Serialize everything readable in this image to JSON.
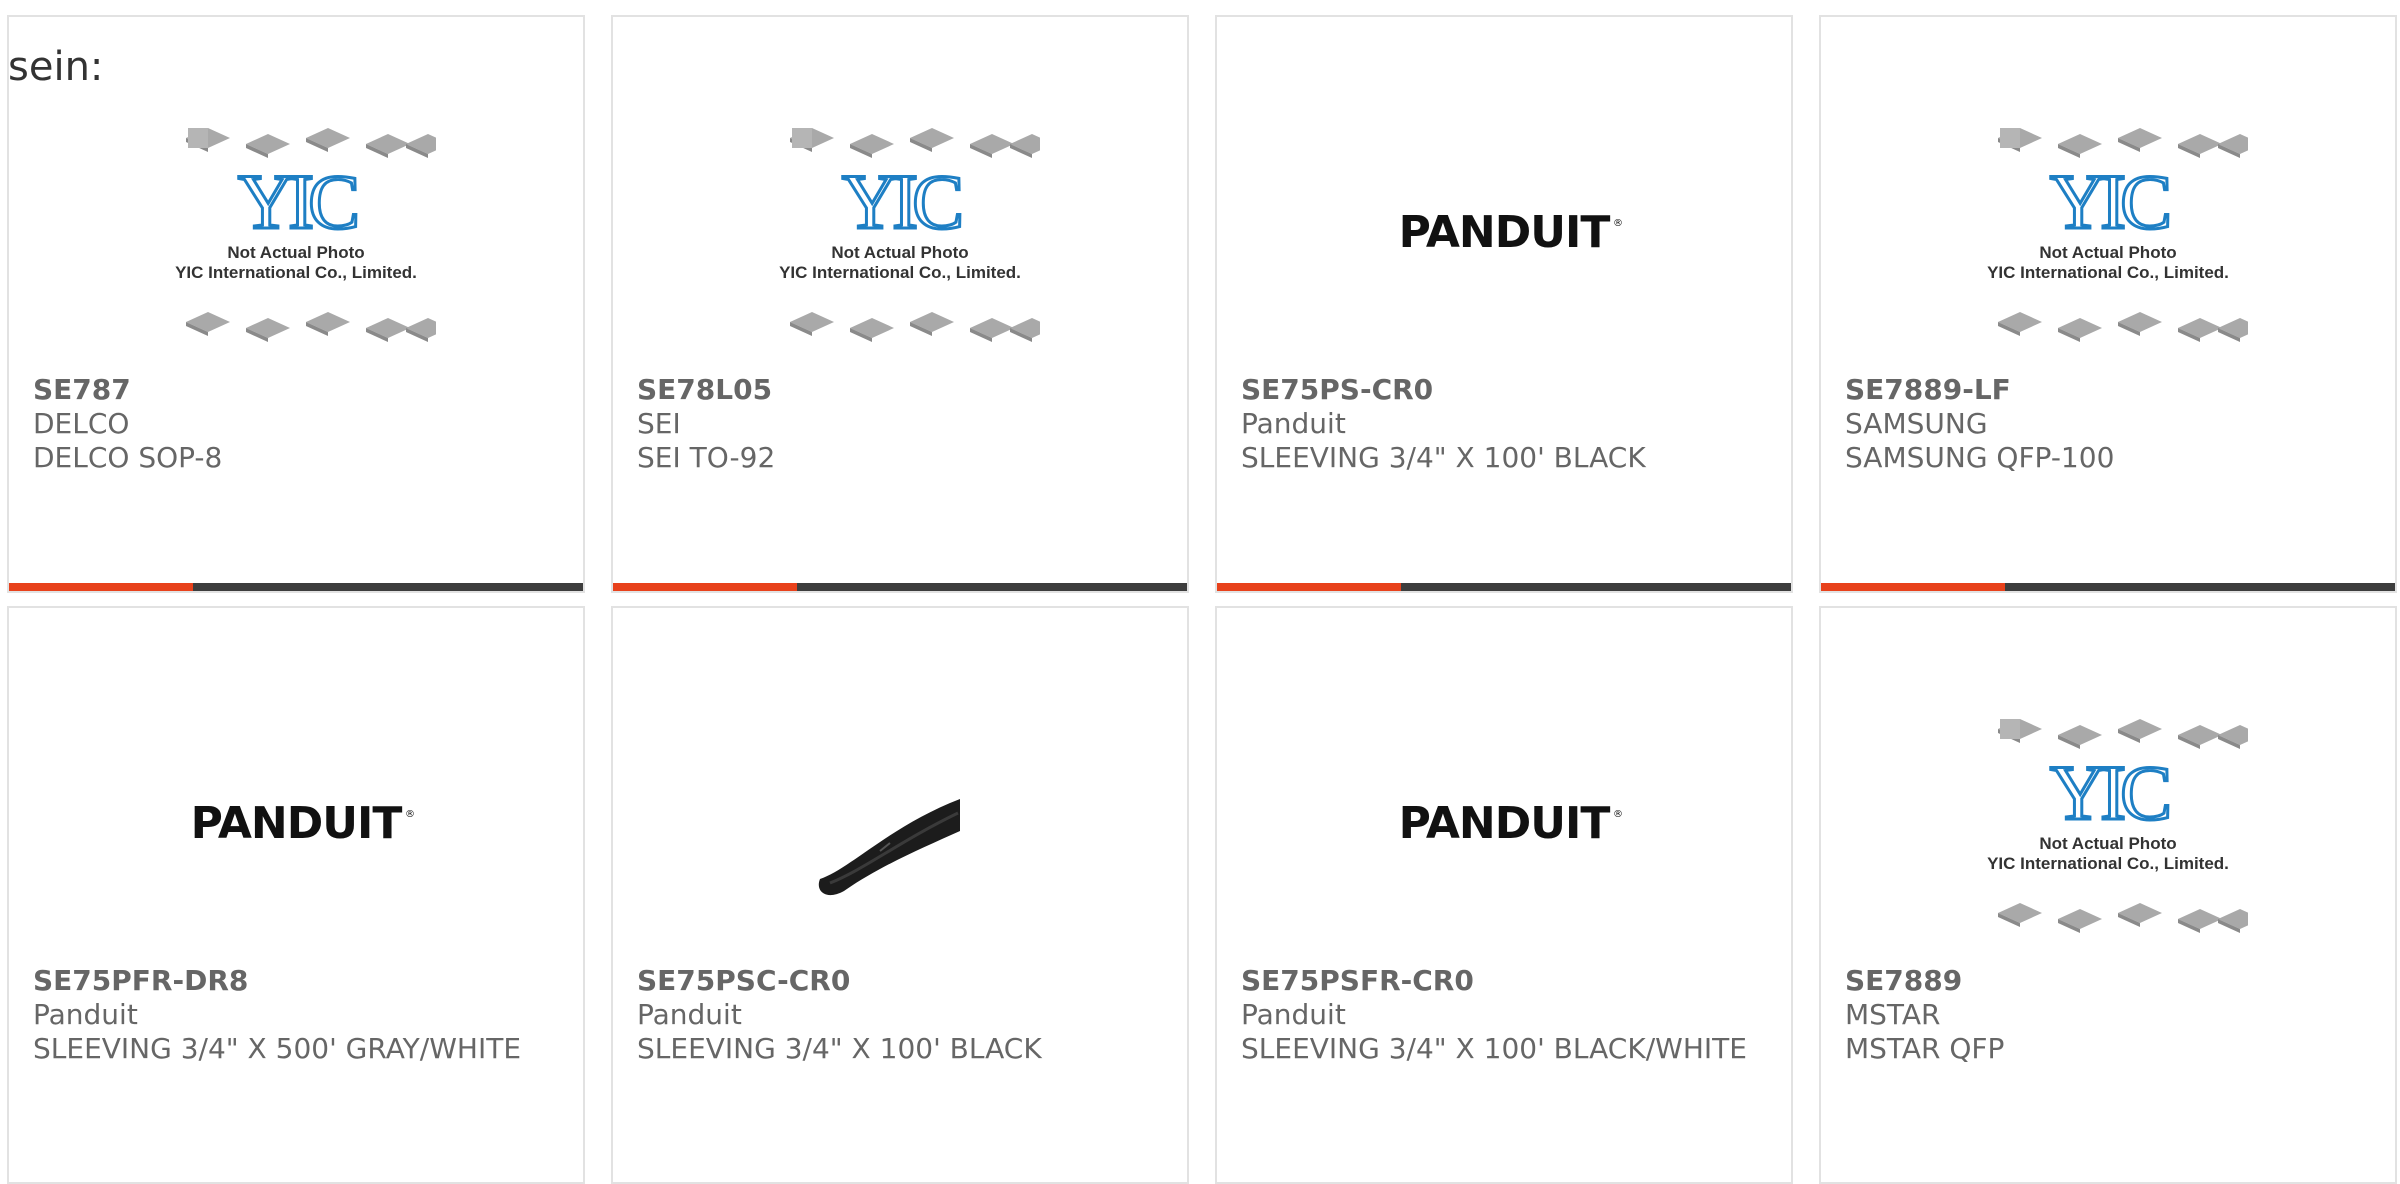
{
  "intro": "sein:",
  "colors": {
    "accent": "#e8411b",
    "bar_dark": "#3d3d3d",
    "text": "#666666",
    "border": "#e2e2e2"
  },
  "products": [
    {
      "part": "SE787",
      "manufacturer": "DELCO",
      "description": "DELCO SOP-8",
      "image": "yic-placeholder",
      "bar_fill": 0.32
    },
    {
      "part": "SE78L05",
      "manufacturer": "SEI",
      "description": "SEI TO-92",
      "image": "yic-placeholder",
      "bar_fill": 0.32
    },
    {
      "part": "SE75PS-CR0",
      "manufacturer": "Panduit",
      "description": "SLEEVING 3/4\" X 100' BLACK",
      "image": "panduit-logo",
      "bar_fill": 0.32
    },
    {
      "part": "SE7889-LF",
      "manufacturer": "SAMSUNG",
      "description": "SAMSUNG QFP-100",
      "image": "yic-placeholder",
      "bar_fill": 0.32
    },
    {
      "part": "SE75PFR-DR8",
      "manufacturer": "Panduit",
      "description": "SLEEVING 3/4\" X 500' GRAY/WHITE",
      "image": "panduit-logo",
      "bar_fill": 0
    },
    {
      "part": "SE75PSC-CR0",
      "manufacturer": "Panduit",
      "description": "SLEEVING 3/4\" X 100' BLACK",
      "image": "black-sleeving-photo",
      "bar_fill": 0
    },
    {
      "part": "SE75PSFR-CR0",
      "manufacturer": "Panduit",
      "description": "SLEEVING 3/4\" X 100' BLACK/WHITE",
      "image": "panduit-logo",
      "bar_fill": 0
    },
    {
      "part": "SE7889",
      "manufacturer": "MSTAR",
      "description": "MSTAR QFP",
      "image": "yic-placeholder",
      "bar_fill": 0
    }
  ],
  "yic_placeholder": {
    "logo": "YIC",
    "line1": "Not Actual Photo",
    "line2": "YIC International Co., Limited."
  },
  "panduit_logo": {
    "text": "PANDUIT",
    "mark": "®"
  }
}
